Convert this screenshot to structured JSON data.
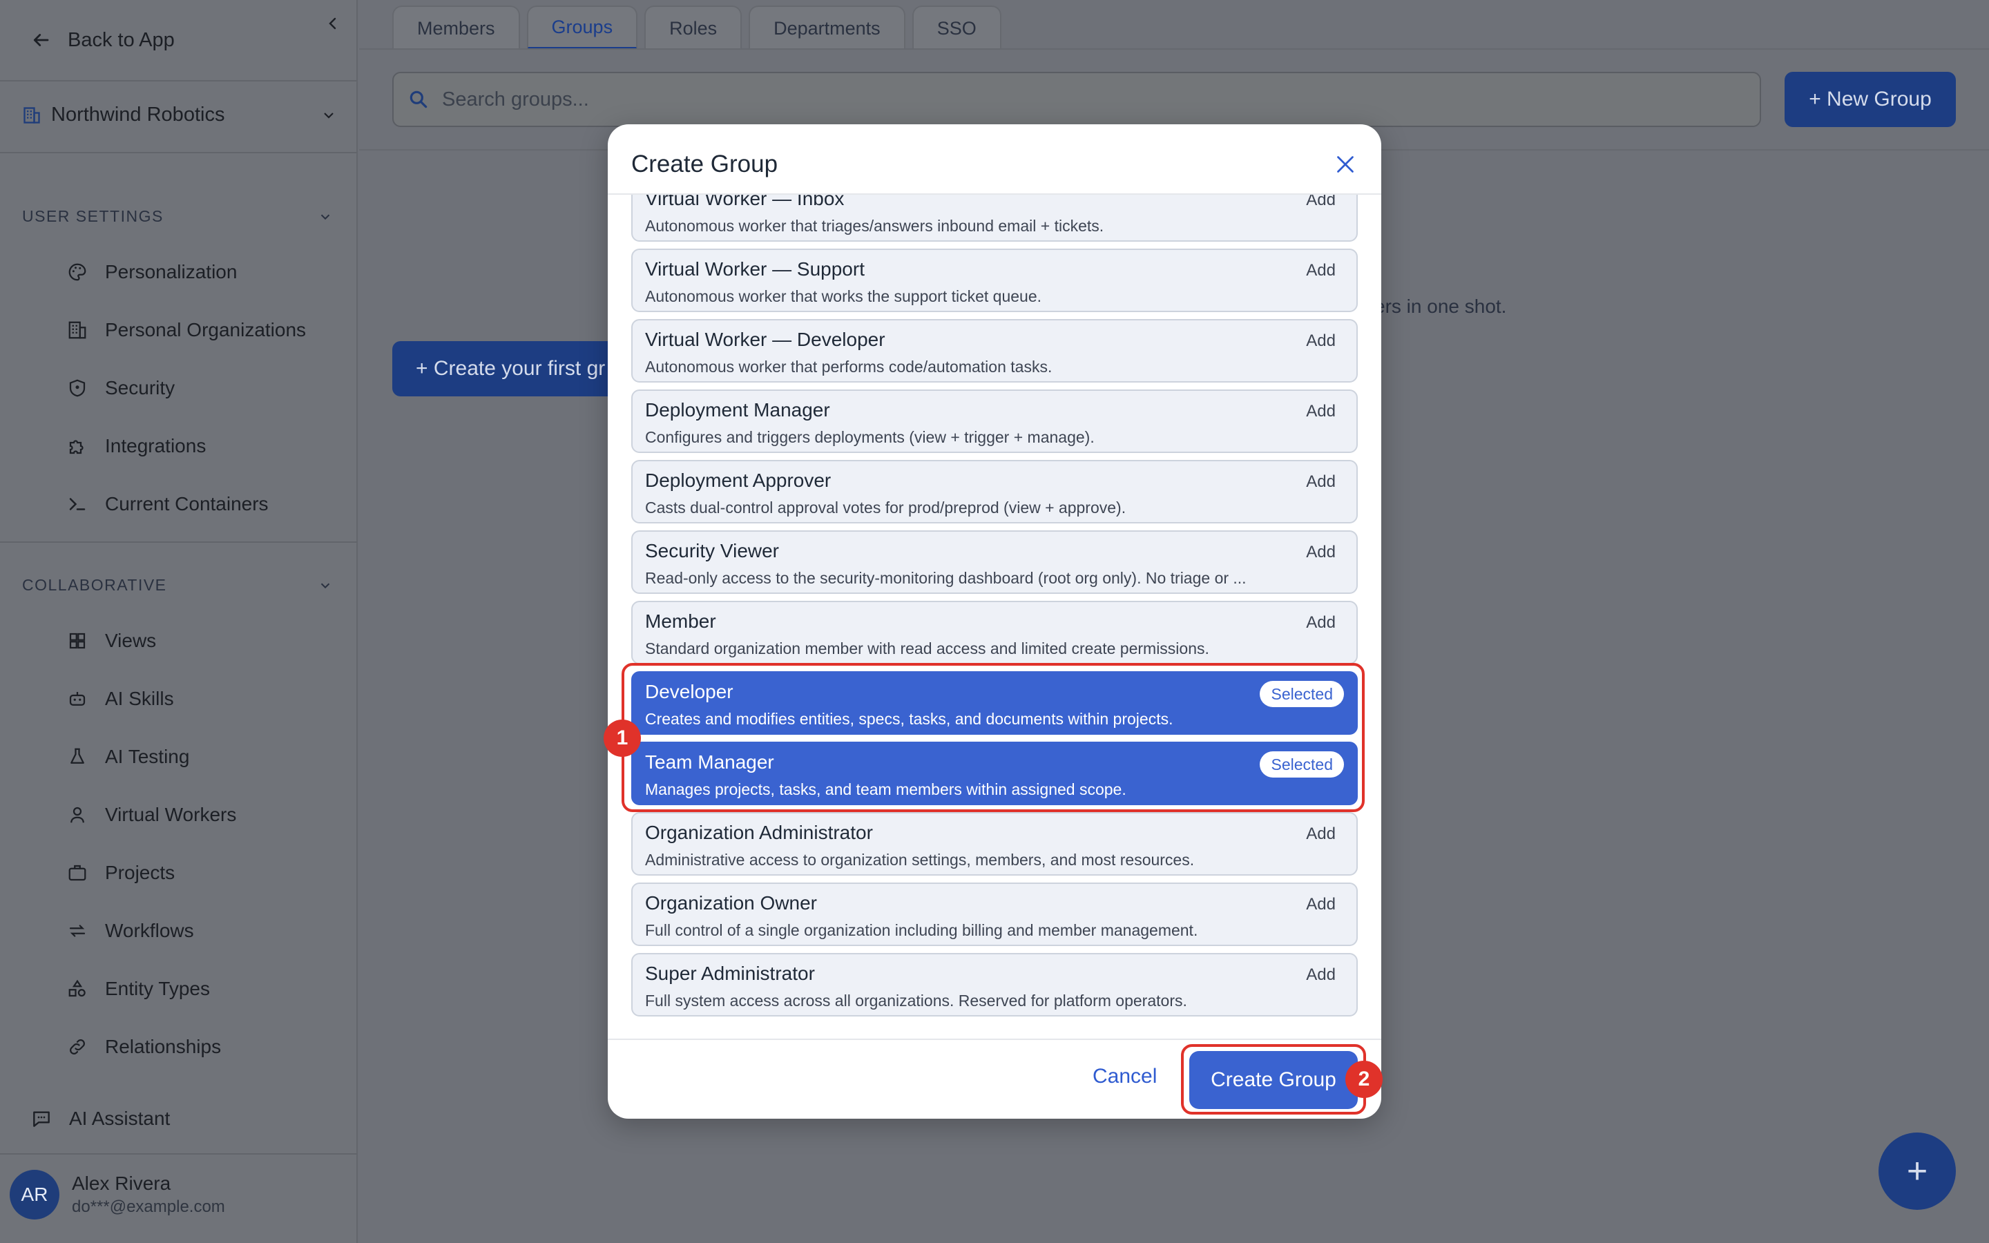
{
  "sidebar": {
    "back_label": "Back to App",
    "org_name": "Northwind Robotics",
    "user_settings_title": "USER SETTINGS",
    "user_settings_items": [
      {
        "label": "Personalization",
        "icon": "palette-icon"
      },
      {
        "label": "Personal Organizations",
        "icon": "building-icon"
      },
      {
        "label": "Security",
        "icon": "shield-icon"
      },
      {
        "label": "Integrations",
        "icon": "puzzle-icon"
      },
      {
        "label": "Current Containers",
        "icon": "terminal-icon"
      }
    ],
    "collaborative_title": "COLLABORATIVE",
    "collaborative_items": [
      {
        "label": "Views",
        "icon": "grid-icon"
      },
      {
        "label": "AI Skills",
        "icon": "robot-icon"
      },
      {
        "label": "AI Testing",
        "icon": "flask-icon"
      },
      {
        "label": "Virtual Workers",
        "icon": "user-worker-icon"
      },
      {
        "label": "Projects",
        "icon": "briefcase-icon"
      },
      {
        "label": "Workflows",
        "icon": "arrows-icon"
      },
      {
        "label": "Entity Types",
        "icon": "shapes-icon"
      },
      {
        "label": "Relationships",
        "icon": "link-icon"
      }
    ],
    "ai_assistant_label": "AI Assistant",
    "user": {
      "initials": "AR",
      "name": "Alex Rivera",
      "email": "do***@example.com"
    }
  },
  "tabs": [
    "Members",
    "Groups",
    "Roles",
    "Departments",
    "SSO"
  ],
  "active_tab": "Groups",
  "search": {
    "placeholder": "Search groups..."
  },
  "new_group_label": "+ New Group",
  "empty_state": {
    "text_fragment": "ers in one shot.",
    "button_label": "+ Create your first gr"
  },
  "fab_label": "+",
  "modal": {
    "title": "Create Group",
    "roles": [
      {
        "name": "Virtual Worker — Inbox",
        "description": "Autonomous worker that triages/answers inbound email + tickets.",
        "action": "Add",
        "selected": false
      },
      {
        "name": "Virtual Worker — Support",
        "description": "Autonomous worker that works the support ticket queue.",
        "action": "Add",
        "selected": false
      },
      {
        "name": "Virtual Worker — Developer",
        "description": "Autonomous worker that performs code/automation tasks.",
        "action": "Add",
        "selected": false
      },
      {
        "name": "Deployment Manager",
        "description": "Configures and triggers deployments (view + trigger + manage).",
        "action": "Add",
        "selected": false
      },
      {
        "name": "Deployment Approver",
        "description": "Casts dual-control approval votes for prod/preprod (view + approve).",
        "action": "Add",
        "selected": false
      },
      {
        "name": "Security Viewer",
        "description": "Read-only access to the security-monitoring dashboard (root org only). No triage or ...",
        "action": "Add",
        "selected": false
      },
      {
        "name": "Member",
        "description": "Standard organization member with read access and limited create permissions.",
        "action": "Add",
        "selected": false
      },
      {
        "name": "Developer",
        "description": "Creates and modifies entities, specs, tasks, and documents within projects.",
        "action": "Selected",
        "selected": true
      },
      {
        "name": "Team Manager",
        "description": "Manages projects, tasks, and team members within assigned scope.",
        "action": "Selected",
        "selected": true
      },
      {
        "name": "Organization Administrator",
        "description": "Administrative access to organization settings, members, and most resources.",
        "action": "Add",
        "selected": false
      },
      {
        "name": "Organization Owner",
        "description": "Full control of a single organization including billing and member management.",
        "action": "Add",
        "selected": false
      },
      {
        "name": "Super Administrator",
        "description": "Full system access across all organizations. Reserved for platform operators.",
        "action": "Add",
        "selected": false
      }
    ],
    "cancel_label": "Cancel",
    "create_label": "Create Group"
  },
  "annotations": [
    {
      "label": "1"
    },
    {
      "label": "2"
    }
  ],
  "colors": {
    "primary": "#3a63d0",
    "annotation": "#e0322a",
    "overlay_bg": "#6e7178"
  }
}
